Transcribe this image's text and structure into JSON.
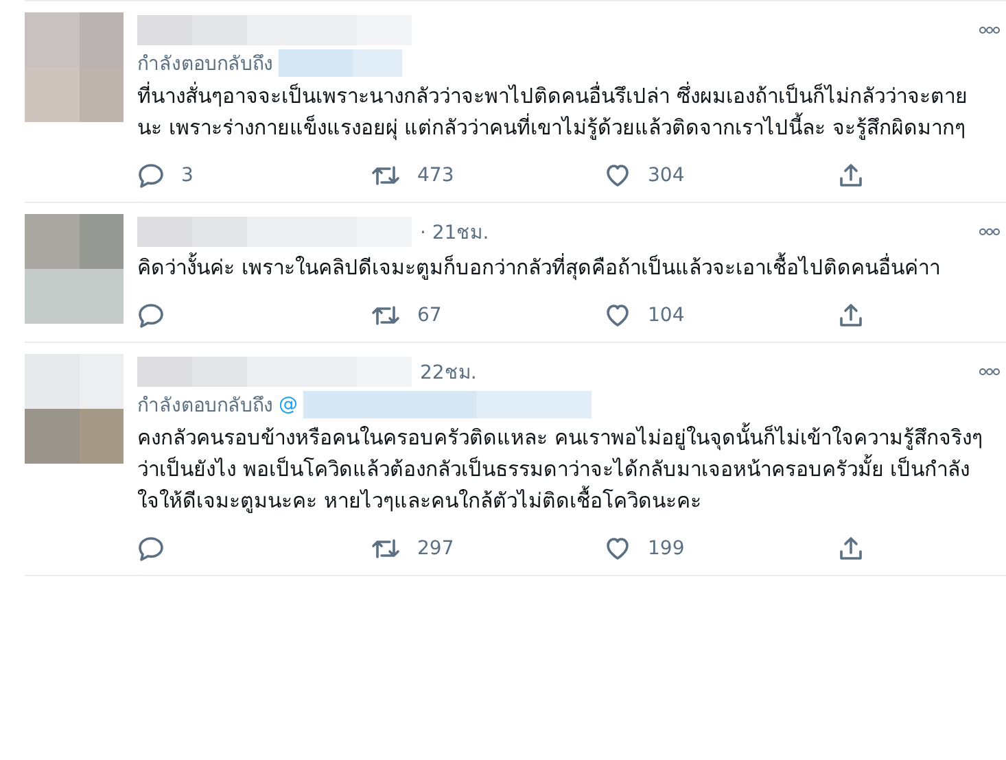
{
  "tweets": [
    {
      "reply_label": "กำลังตอบกลับถึง",
      "text": "ที่นางสั่นๆอาจจะเป็นเพราะนางกลัวว่าจะพาไปติดคนอื่นรึเปล่า ซึ่งผมเองถ้าเป็นก็ไม่กลัวว่าจะตายนะ เพราะร่างกายแข็งแรงอยผุ่ แต่กลัวว่าคนที่เขาไม่รู้ด้วยแล้วติดจากเราไปนี้ละ จะรู้สึกผิดมากๆ",
      "replies": "3",
      "retweets": "473",
      "likes": "304"
    },
    {
      "time": "· 21ชม.",
      "text": "คิดว่างั้นค่ะ เพราะในคลิปดีเจมะตูมก็บอกว่ากลัวที่สุดคือถ้าเป็นแล้วจะเอาเชื้อไปติดคนอื่นค่าา",
      "retweets": "67",
      "likes": "104"
    },
    {
      "time": "22ชม.",
      "reply_label": "กำลังตอบกลับถึง",
      "reply_handle": "@",
      "text": "คงกลัวคนรอบข้างหรือคนในครอบครัวติดแหละ คนเราพอไม่อยู่ในจุดนั้นก็ไม่เข้าใจความรู้สึกจริงๆว่าเป็นยังไง พอเป็นโควิดแล้วต้องกลัวเป็นธรรมดาว่าจะได้กลับมาเจอหน้าครอบครัวมั้ย เป็นกำลังใจให้ดีเจมะตูมนะคะ หายไวๆและคนใกล้ตัวไม่ติดเชื้อโควิดนะคะ",
      "retweets": "297",
      "likes": "199"
    }
  ]
}
